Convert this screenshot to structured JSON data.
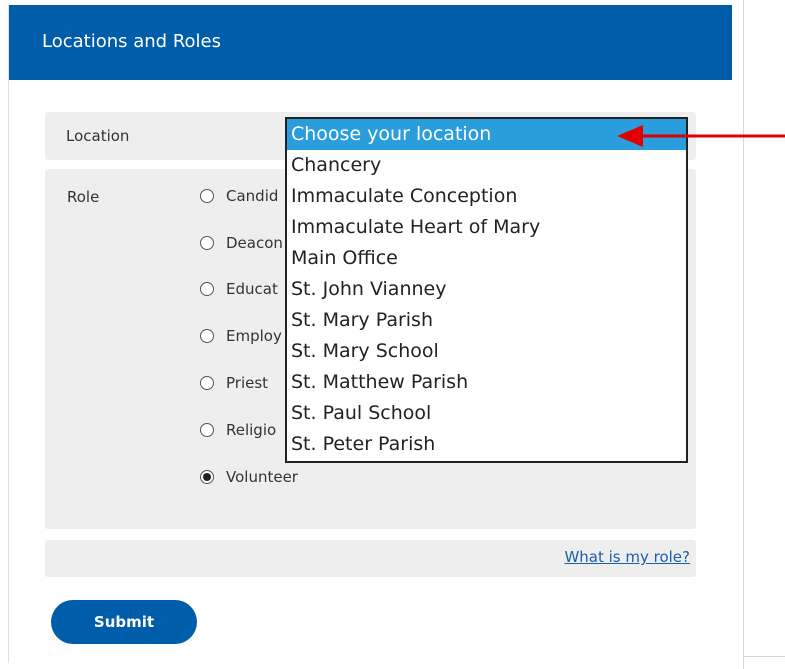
{
  "header": {
    "title": "Locations and Roles"
  },
  "location": {
    "label": "Location",
    "options": [
      "Choose your location",
      "Chancery",
      "Immaculate Conception",
      "Immaculate Heart of Mary",
      "Main Office",
      "St. John Vianney",
      "St. Mary Parish",
      "St. Mary School",
      "St. Matthew Parish",
      "St. Paul School",
      "St. Peter Parish"
    ],
    "highlighted": "Choose your location"
  },
  "role": {
    "label": "Role",
    "options": [
      "Candid",
      "Deacon",
      "Educat",
      "Employ",
      "Priest",
      "Religio",
      "Volunteer"
    ],
    "selected": "Volunteer"
  },
  "help": {
    "link_text": "What is my role?"
  },
  "submit": {
    "label": "Submit"
  },
  "colors": {
    "header_bg": "#005daa",
    "highlight": "#2a9edc",
    "annotation_arrow": "#e00000"
  }
}
